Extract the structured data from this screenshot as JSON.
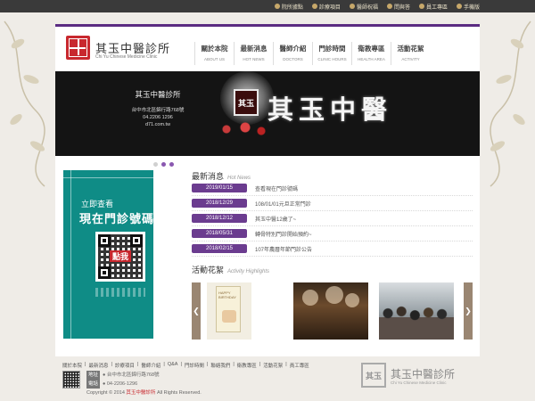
{
  "topbar": {
    "links": [
      {
        "label": "院所據點",
        "icon": "location-icon"
      },
      {
        "label": "診療項目",
        "icon": "plus-icon"
      },
      {
        "label": "醫師祝福",
        "icon": "doctor-icon"
      },
      {
        "label": "問與答",
        "icon": "qa-icon"
      },
      {
        "label": "員工專區",
        "icon": "staff-icon"
      },
      {
        "label": "手機版",
        "icon": "mobile-icon"
      }
    ]
  },
  "brand": {
    "name": "其玉中醫診所",
    "subtitle": "Chi Yu Chinese Medicine Clinic",
    "seal_text": "其玉"
  },
  "nav": [
    {
      "zh": "關於本院",
      "en": "ABOUT US"
    },
    {
      "zh": "最新消息",
      "en": "HOT NEWS"
    },
    {
      "zh": "醫師介紹",
      "en": "DOCTORS"
    },
    {
      "zh": "門診時間",
      "en": "CLINIC HOURS"
    },
    {
      "zh": "衛教專區",
      "en": "HEALTH AREA"
    },
    {
      "zh": "活動花絮",
      "en": "ACTIVITY"
    }
  ],
  "banner": {
    "clinic": "其玉中醫診所",
    "address": "台中市北區錦行路768號",
    "phone": "04.2206 1296",
    "url": "d71.com.tw",
    "sign": "其玉中醫",
    "seal": "其玉"
  },
  "promo": {
    "line1": "立即查看",
    "line2": "現在門診號碼",
    "qr_tag": "點我"
  },
  "news": {
    "title": "最新消息",
    "title_en": "Hot News",
    "items": [
      {
        "date": "2019/01/15",
        "title": "查看現在門診號碼"
      },
      {
        "date": "2018/12/29",
        "title": "108/01/01元旦正常門診"
      },
      {
        "date": "2018/12/12",
        "title": "其玉中醫12歲了~"
      },
      {
        "date": "2018/05/31",
        "title": "轉骨特別門診開始預約~"
      },
      {
        "date": "2018/02/15",
        "title": "107年農曆年節門診公告"
      }
    ]
  },
  "activity": {
    "title": "活動花絮",
    "title_en": "Activity Highlights",
    "card_text": "HAPPY BIRTHDAY",
    "prev": "❮",
    "next": "❯"
  },
  "footer": {
    "links": [
      "關於本院",
      "最新消息",
      "診療項目",
      "醫師介紹",
      "Q&A",
      "門診時間",
      "聯絡我們",
      "衛教專區",
      "活動花絮",
      "員工專區"
    ],
    "separator": "|",
    "address_badge": "地址",
    "address": "台中市北區錦行路768號",
    "phone_badge": "電話",
    "phone": "04-2206-1296",
    "copyright_pre": "Copyright © 2014",
    "copyright_name": "其玉中醫診所",
    "copyright_post": "All Rights Reserved.",
    "brand": "其玉中醫診所",
    "brand_sub": "Chi Yu Chinese Medicine Clinic",
    "seal": "其玉"
  }
}
